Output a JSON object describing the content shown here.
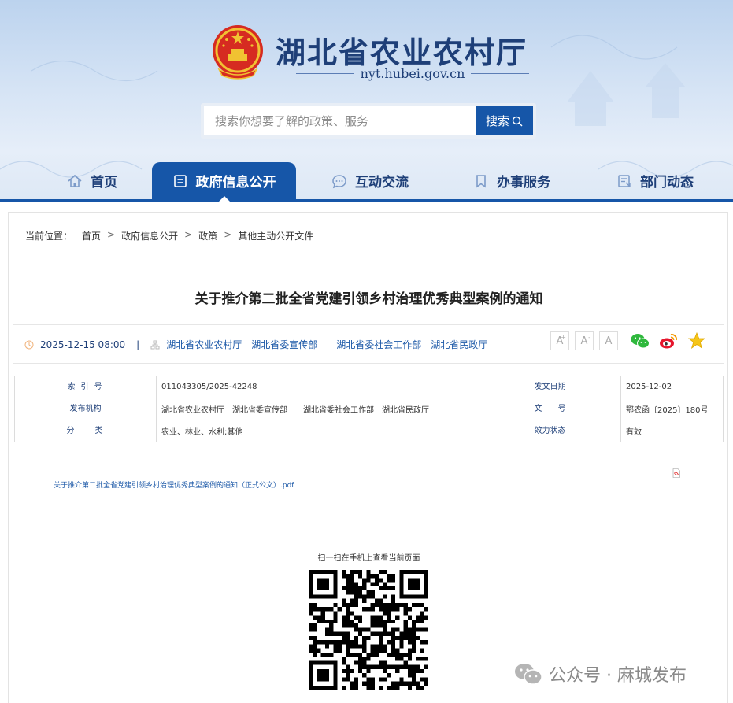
{
  "header": {
    "site_title": "湖北省农业农村厅",
    "site_url": "nyt.hubei.gov.cn",
    "search": {
      "placeholder": "搜索你想要了解的政策、服务",
      "button_label": "搜索"
    }
  },
  "nav": [
    {
      "label": "首页",
      "icon": "home-icon"
    },
    {
      "label": "政府信息公开",
      "icon": "document-list-icon",
      "active": true
    },
    {
      "label": "互动交流",
      "icon": "chat-icon"
    },
    {
      "label": "办事服务",
      "icon": "bookmark-icon"
    },
    {
      "label": "部门动态",
      "icon": "news-icon"
    }
  ],
  "breadcrumb": {
    "prefix": "当前位置：",
    "items": [
      "首页",
      "政府信息公开",
      "政策",
      "其他主动公开文件"
    ],
    "separator": ">"
  },
  "article": {
    "title": "关于推介第二批全省党建引领乡村治理优秀典型案例的通知",
    "date": "2025-12-15 08:00",
    "separator": "|",
    "publishers": [
      "湖北省农业农村厅",
      "湖北省委宣传部",
      "湖北省委社会工作部",
      "湖北省民政厅"
    ],
    "font_size_buttons": [
      {
        "label": "A",
        "sup": "+"
      },
      {
        "label": "A",
        "sup": "-"
      },
      {
        "label": "A",
        "sup": ""
      }
    ],
    "share_icons": [
      "wechat-icon",
      "weibo-icon",
      "favorite-star-icon"
    ]
  },
  "info_table": {
    "rows": [
      {
        "k1": "索 引 号",
        "v1": "011043305/2025-42248",
        "k2": "发文日期",
        "v2": "2025-12-02"
      },
      {
        "k1": "发布机构",
        "v1": "湖北省农业农村厅　湖北省委宣传部　　湖北省委社会工作部　湖北省民政厅",
        "k2": "文　　号",
        "v2": "鄂农函〔2025〕180号"
      },
      {
        "k1": "分　　类",
        "v1": "农业、林业、水利;其他",
        "k2": "效力状态",
        "v2": "有效"
      }
    ]
  },
  "attachment": {
    "label": "关于推介第二批全省党建引领乡村治理优秀典型案例的通知（正式公文）.pdf"
  },
  "qr": {
    "label": "扫一扫在手机上查看当前页面"
  },
  "watermark": {
    "text": "公众号 · 麻城发布"
  },
  "colors": {
    "primary": "#1656a8",
    "title_blue": "#1e3f78",
    "link_blue": "#1e5aa8"
  }
}
